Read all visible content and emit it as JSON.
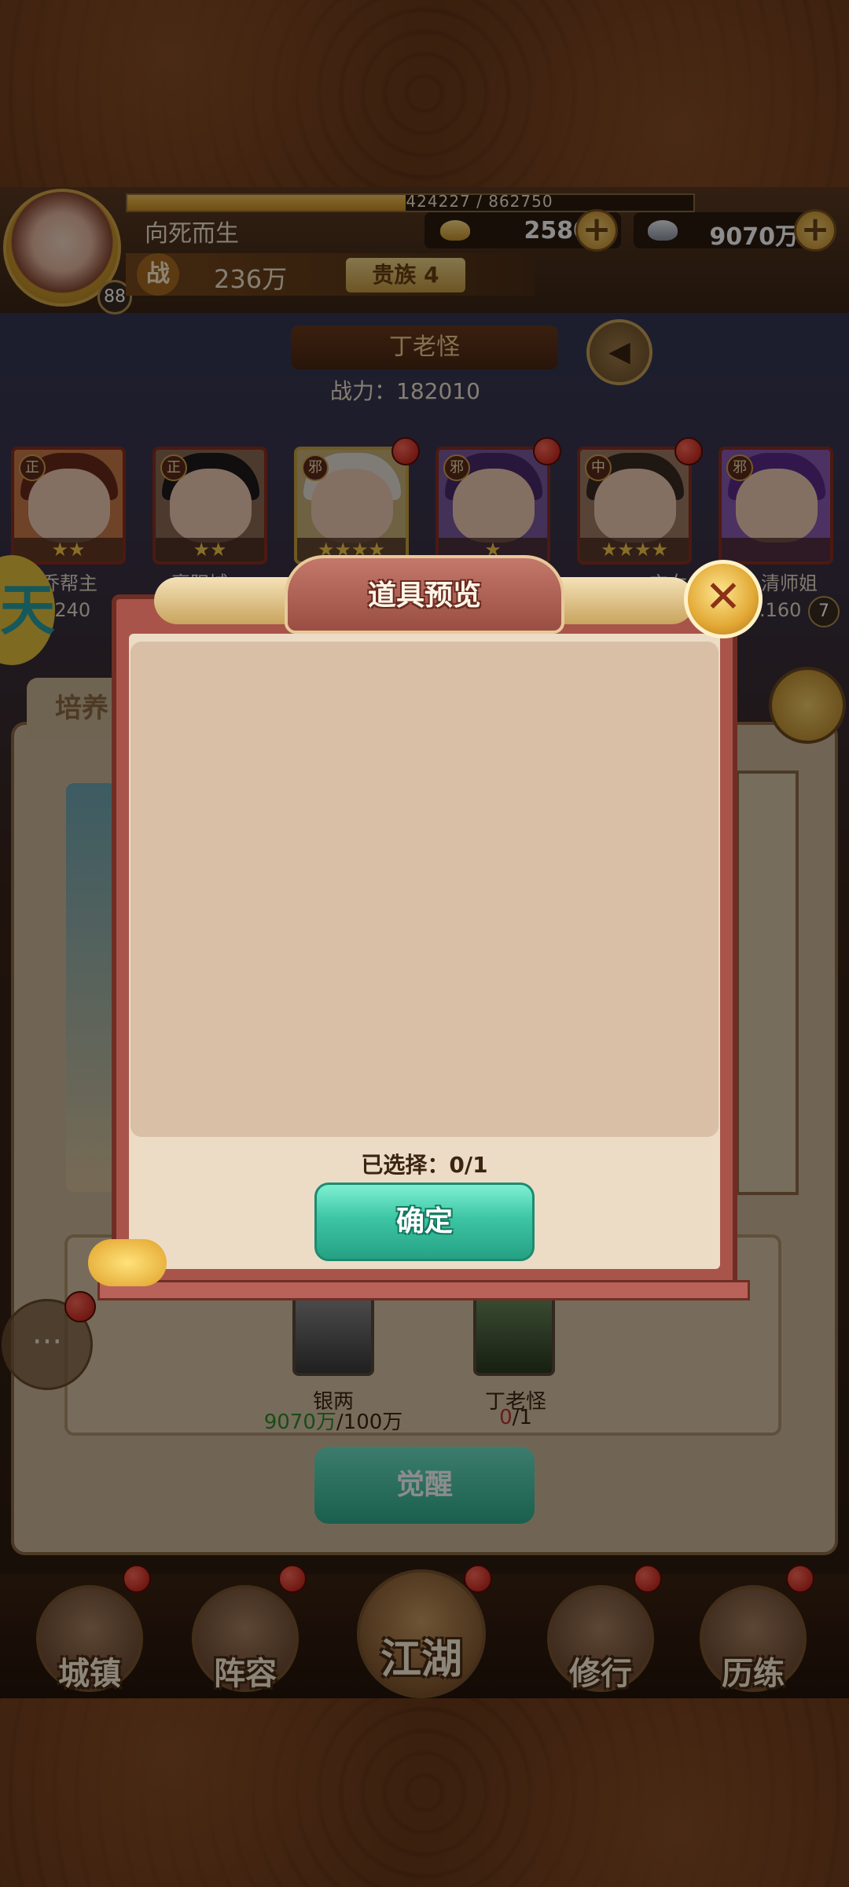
{
  "header": {
    "player_name": "向死而生",
    "level": "88",
    "exp_text": "424227 / 862750",
    "exp_fraction": 0.4917,
    "gold": "2580",
    "silver": "9070万",
    "battle_icon": "战",
    "battle_power": "236万",
    "noble_rank": "贵族 4"
  },
  "stage": {
    "npc_name": "丁老怪",
    "npc_power": "战力：182010"
  },
  "heroes": [
    {
      "faction": "正",
      "stars": "★★",
      "label": "乔帮主",
      "level": "Lv.240"
    },
    {
      "faction": "正",
      "stars": "★★",
      "label": "襄阳城"
    },
    {
      "faction": "邪",
      "stars": "★★★★",
      "label": ""
    },
    {
      "faction": "邪",
      "stars": "★",
      "label": ""
    },
    {
      "faction": "中",
      "stars": "★★★★",
      "label": "玄女"
    },
    {
      "faction": "邪",
      "stars": "",
      "label": "清师姐",
      "level": ".160",
      "badge": "7"
    }
  ],
  "background_panel": {
    "tab_label": "培养",
    "requirements": [
      {
        "name": "银两",
        "have": "9070万",
        "need": "/100万"
      },
      {
        "name": "丁老怪",
        "have": "0",
        "need": "/1"
      }
    ],
    "awaken_label": "觉醒"
  },
  "dialog": {
    "title": "道具预览",
    "selected_text": "已选择：0/1",
    "confirm_label": "确定"
  },
  "nav": [
    {
      "label": "城镇"
    },
    {
      "label": "阵容"
    },
    {
      "label": "江湖"
    },
    {
      "label": "修行"
    },
    {
      "label": "历练"
    }
  ],
  "left_badge": "天",
  "colors": {
    "accent_green": "#2fae8f",
    "dialog_frame": "#a9544a",
    "have_green": "#2f8a2a",
    "need_red": "#c0302a"
  }
}
